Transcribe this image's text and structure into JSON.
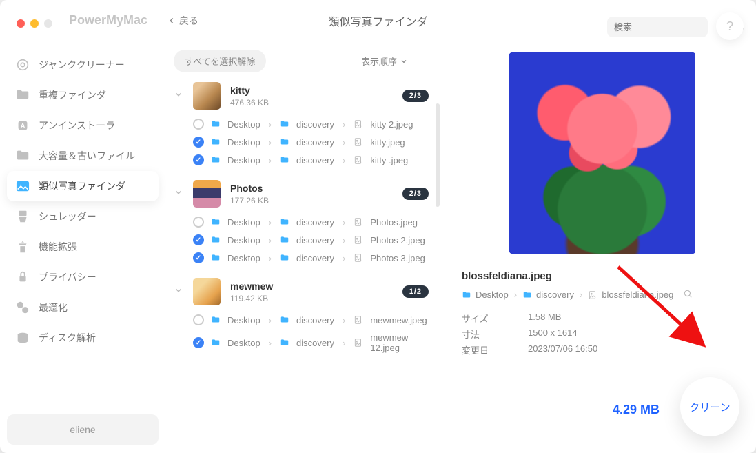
{
  "app_name": "PowerMyMac",
  "back_label": "戻る",
  "title": "類似写真ファインダ",
  "search_placeholder": "検索",
  "help_label": "?",
  "sidebar": {
    "items": [
      {
        "label": "ジャンククリーナー"
      },
      {
        "label": "重複ファインダ"
      },
      {
        "label": "アンインストーラ"
      },
      {
        "label": "大容量＆古いファイル"
      },
      {
        "label": "類似写真ファインダ"
      },
      {
        "label": "シュレッダー"
      },
      {
        "label": "機能拡張"
      },
      {
        "label": "プライバシー"
      },
      {
        "label": "最適化"
      },
      {
        "label": "ディスク解析"
      }
    ],
    "active_index": 4,
    "user": "eliene"
  },
  "controls": {
    "deselect_all": "すべてを選択解除",
    "sort_order": "表示順序"
  },
  "crumb": {
    "desktop": "Desktop",
    "discovery": "discovery"
  },
  "groups": [
    {
      "thumb": "kitty",
      "name": "kitty",
      "size": "476.36 KB",
      "badge": "2/3",
      "files": [
        {
          "checked": false,
          "name": "kitty 2.jpeg"
        },
        {
          "checked": true,
          "name": "kitty.jpeg"
        },
        {
          "checked": true,
          "name": "kitty .jpeg"
        }
      ]
    },
    {
      "thumb": "photos",
      "name": "Photos",
      "size": "177.26 KB",
      "badge": "2/3",
      "files": [
        {
          "checked": false,
          "name": "Photos.jpeg"
        },
        {
          "checked": true,
          "name": "Photos 2.jpeg"
        },
        {
          "checked": true,
          "name": "Photos 3.jpeg"
        }
      ]
    },
    {
      "thumb": "mewmew",
      "name": "mewmew",
      "size": "119.42 KB",
      "badge": "1/2",
      "files": [
        {
          "checked": false,
          "name": "mewmew.jpeg"
        },
        {
          "checked": true,
          "name": "mewmew 12.jpeg"
        }
      ]
    }
  ],
  "preview": {
    "filename": "blossfeldiana.jpeg",
    "path_desktop": "Desktop",
    "path_discovery": "discovery",
    "path_file": "blossfeldiana.jpeg",
    "meta": {
      "size_label": "サイズ",
      "size_value": "1.58 MB",
      "dims_label": "寸法",
      "dims_value": "1500 x 1614",
      "mod_label": "変更日",
      "mod_value": "2023/07/06 16:50"
    }
  },
  "footer": {
    "total_size": "4.29 MB",
    "clean_label": "クリーン"
  }
}
